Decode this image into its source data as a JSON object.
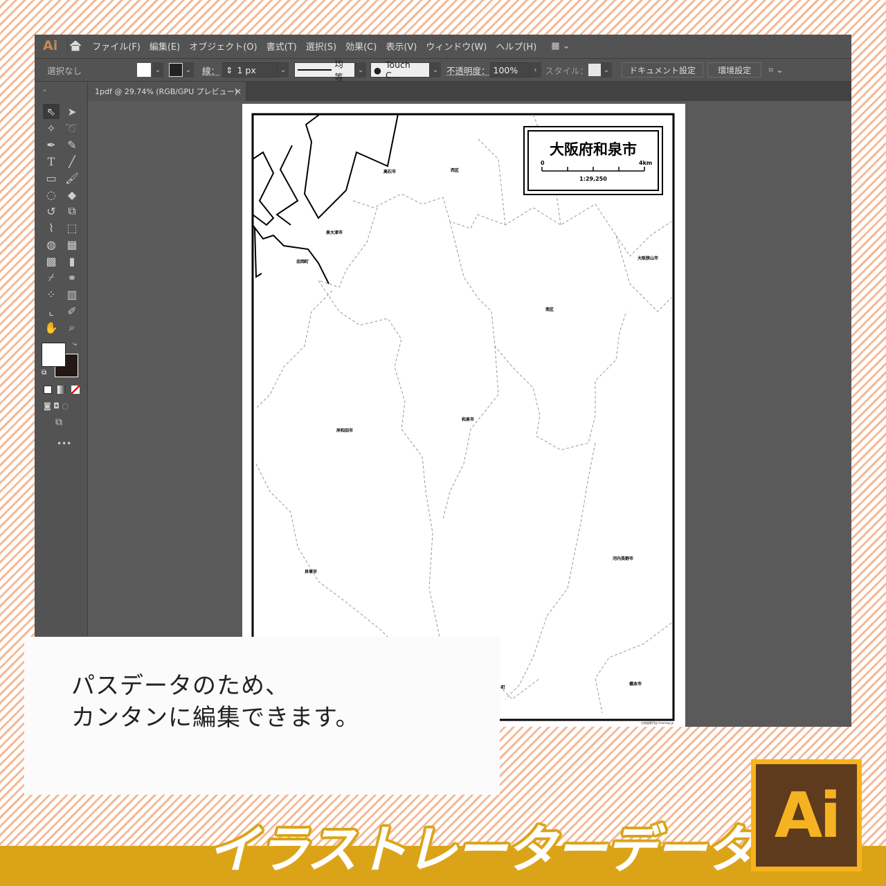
{
  "app": {
    "logo": "Ai"
  },
  "menu": [
    "ファイル(F)",
    "編集(E)",
    "オブジェクト(O)",
    "書式(T)",
    "選択(S)",
    "効果(C)",
    "表示(V)",
    "ウィンドウ(W)",
    "ヘルプ(H)"
  ],
  "control": {
    "selection": "選択なし",
    "stroke_label": "線：",
    "stroke_value": "1 px",
    "stroke_profile": "均等",
    "brush": "Touch C...",
    "opacity_label": "不透明度：",
    "opacity_value": "100%",
    "style_label": "スタイル：",
    "doc_setup": "ドキュメント設定",
    "preferences": "環境設定"
  },
  "tab": {
    "title": "1pdf @ 29.74% (RGB/GPU プレビュー)",
    "close": "×"
  },
  "map": {
    "title": "大阪府和泉市",
    "scale_start": "0",
    "scale_end": "4km",
    "scale_ratio": "1:29,250",
    "credit": "白地図専門店 freemap.jp",
    "places": [
      "高石市",
      "西区",
      "泉大津市",
      "忠岡町",
      "大阪狭山市",
      "南区",
      "和泉市",
      "岸和田市",
      "河内長野市",
      "貝塚市",
      "橋本市",
      "町"
    ]
  },
  "overlay": {
    "line1": "パスデータのため、",
    "line2": "カンタンに編集できます。"
  },
  "banner": {
    "text": "イラストレーターデータ",
    "logo": "Ai"
  }
}
